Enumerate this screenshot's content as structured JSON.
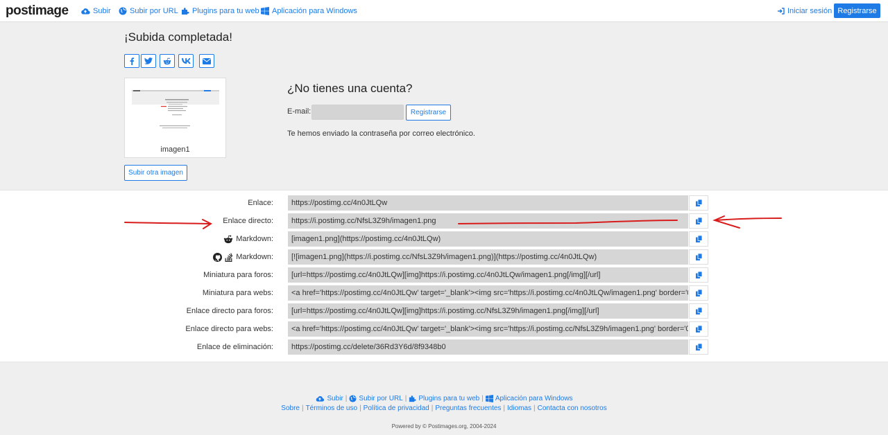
{
  "navbar": {
    "brand": "postimage",
    "links": [
      {
        "label": "Subir",
        "icon": "cloud-upload-icon"
      },
      {
        "label": "Subir por URL",
        "icon": "globe-icon"
      },
      {
        "label": "Plugins para tu web",
        "icon": "puzzle-icon"
      },
      {
        "label": "Aplicación para Windows",
        "icon": "windows-icon"
      }
    ],
    "login": "Iniciar sesión",
    "register": "Registrarse"
  },
  "upload": {
    "title": "¡Subida completada!",
    "share_icons": [
      "facebook-icon",
      "twitter-icon",
      "reddit-icon",
      "vk-icon",
      "email-icon"
    ],
    "thumb_caption": "imagen1",
    "upload_another": "Subir otra imagen"
  },
  "account": {
    "title": "¿No tienes una cuenta?",
    "email_label": "E-mail:",
    "email_value": "",
    "register_button": "Registrarse",
    "message": "Te hemos enviado la contraseña por correo electrónico."
  },
  "links": [
    {
      "label": "Enlace:",
      "value": "https://postimg.cc/4n0JtLQw"
    },
    {
      "label": "Enlace directo:",
      "value": "https://i.postimg.cc/NfsL3Z9h/imagen1.png"
    },
    {
      "label": "Markdown:",
      "value": "[imagen1.png](https://postimg.cc/4n0JtLQw)",
      "icons": [
        "reddit-icon"
      ]
    },
    {
      "label": "Markdown:",
      "value": "[![imagen1.png](https://i.postimg.cc/NfsL3Z9h/imagen1.png)](https://postimg.cc/4n0JtLQw)",
      "icons": [
        "github-icon",
        "stackoverflow-icon"
      ]
    },
    {
      "label": "Miniatura para foros:",
      "value": "[url=https://postimg.cc/4n0JtLQw][img]https://i.postimg.cc/4n0JtLQw/imagen1.png[/img][/url]"
    },
    {
      "label": "Miniatura para webs:",
      "value": "<a href='https://postimg.cc/4n0JtLQw' target='_blank'><img src='https://i.postimg.cc/4n0JtLQw/imagen1.png' border='0"
    },
    {
      "label": "Enlace directo para foros:",
      "value": "[url=https://postimg.cc/4n0JtLQw][img]https://i.postimg.cc/NfsL3Z9h/imagen1.png[/img][/url]"
    },
    {
      "label": "Enlace directo para webs:",
      "value": "<a href='https://postimg.cc/4n0JtLQw' target='_blank'><img src='https://i.postimg.cc/NfsL3Z9h/imagen1.png' border='0'"
    },
    {
      "label": "Enlace de eliminación:",
      "value": "https://postimg.cc/delete/36Rd3Y6d/8f9348b0"
    }
  ],
  "footer": {
    "row1": [
      "Subir",
      "Subir por URL",
      "Plugins para tu web",
      "Aplicación para Windows"
    ],
    "row2": [
      "Sobre",
      "Términos de uso",
      "Política de privacidad",
      "Preguntas frecuentes",
      "Idiomas",
      "Contacta con nosotros"
    ],
    "copyright": "Powered by © Postimages.org, 2004-2024"
  },
  "colors": {
    "accent": "#1e7be6",
    "annotation": "#d81b1b"
  }
}
